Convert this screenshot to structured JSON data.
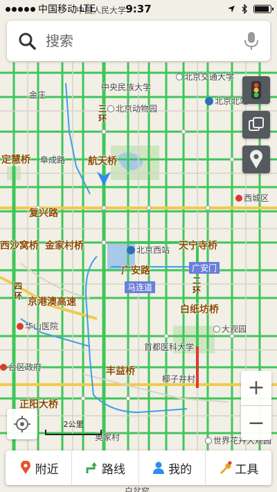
{
  "status_bar": {
    "carrier": "中国移动",
    "network": "LTE",
    "time": "9:37"
  },
  "search": {
    "placeholder": "搜索"
  },
  "map": {
    "labels": [
      {
        "text": "中国人民大学",
        "kind": "area",
        "icon": "none"
      },
      {
        "text": "中央民族大学",
        "kind": "area",
        "icon": "none"
      },
      {
        "text": "北京交通大学",
        "kind": "area",
        "icon": "poi-dot"
      },
      {
        "text": "北京北站",
        "kind": "area",
        "icon": "poi-metro"
      },
      {
        "text": "北京动物园",
        "kind": "area",
        "icon": "poi-dot"
      },
      {
        "text": "金庄",
        "kind": "area",
        "icon": "none"
      },
      {
        "text": "三环",
        "kind": "ring",
        "icon": "none"
      },
      {
        "text": "定慧桥",
        "kind": "road",
        "icon": "none"
      },
      {
        "text": "阜成路",
        "kind": "road",
        "icon": "none"
      },
      {
        "text": "航天桥",
        "kind": "road",
        "icon": "none"
      },
      {
        "text": "西城区",
        "kind": "area",
        "icon": "poi-red"
      },
      {
        "text": "复兴路",
        "kind": "road",
        "icon": "none"
      },
      {
        "text": "西沙窝桥",
        "kind": "road",
        "icon": "none"
      },
      {
        "text": "金家村桥",
        "kind": "road",
        "icon": "none"
      },
      {
        "text": "北京西站",
        "kind": "area",
        "icon": "poi-metro"
      },
      {
        "text": "天宁寺桥",
        "kind": "road",
        "icon": "none"
      },
      {
        "text": "广安路",
        "kind": "road",
        "icon": "none"
      },
      {
        "text": "广安门",
        "kind": "blue",
        "icon": "none"
      },
      {
        "text": "马连道",
        "kind": "blue",
        "icon": "none"
      },
      {
        "text": "四环",
        "kind": "ring",
        "icon": "none"
      },
      {
        "text": "京港澳高速",
        "kind": "road",
        "icon": "none"
      },
      {
        "text": "二环",
        "kind": "ring",
        "icon": "none"
      },
      {
        "text": "白纸坊桥",
        "kind": "road",
        "icon": "none"
      },
      {
        "text": "华山医院",
        "kind": "area",
        "icon": "poi-red"
      },
      {
        "text": "大观园",
        "kind": "area",
        "icon": "poi-dot"
      },
      {
        "text": "首都医科大学",
        "kind": "area",
        "icon": "none"
      },
      {
        "text": "台区政府",
        "kind": "area",
        "icon": "poi-red"
      },
      {
        "text": "丰益桥",
        "kind": "road",
        "icon": "none"
      },
      {
        "text": "椰子井村",
        "kind": "area",
        "icon": "none"
      },
      {
        "text": "正阳大桥",
        "kind": "road",
        "icon": "none"
      },
      {
        "text": "奥家村",
        "kind": "area",
        "icon": "none"
      },
      {
        "text": "世界花卉大观园",
        "kind": "area",
        "icon": "poi-dot"
      },
      {
        "text": "白盆窑",
        "kind": "area",
        "icon": "none"
      }
    ]
  },
  "scale": {
    "label": "2公里"
  },
  "bottom_nav": {
    "nearby": "附近",
    "route": "路线",
    "mine": "我的",
    "tools": "工具"
  },
  "colors": {
    "road_green": "#3fc65a",
    "highway_yellow": "#f2c94c",
    "ring_road": "#f7d36b",
    "water": "#a8c8e8",
    "park": "#cfe5c2",
    "background": "#f2efe6",
    "route_blue": "#3d9ee8",
    "accent_red": "#d93b2e"
  }
}
